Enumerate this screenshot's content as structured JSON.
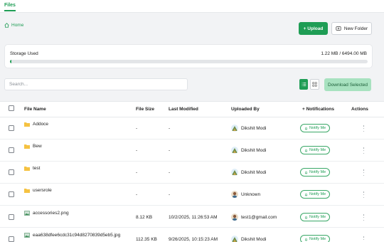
{
  "tabs": {
    "files": "Files"
  },
  "breadcrumb": {
    "home": "Home"
  },
  "actions": {
    "upload": "+ Upload",
    "new_folder": "New Folder",
    "download_selected": "Download Selected"
  },
  "storage": {
    "label": "Storage Used",
    "value": "1.22 MB / 6494.00 MB",
    "used_fraction": 0.0002
  },
  "search": {
    "placeholder": "Search..."
  },
  "table": {
    "headers": {
      "file_name": "File Name",
      "file_size": "File Size",
      "last_modified": "Last Modified",
      "uploaded_by": "Uploaded By",
      "notifications": "+ Notifications",
      "actions": "Actions"
    },
    "notify_label": "Notify Me",
    "rows": [
      {
        "name": "Addoce",
        "type": "folder",
        "size": "-",
        "modified": "-",
        "uploaded_by": "Dikshit Modi",
        "avatar": "landscape-avatar"
      },
      {
        "name": "Bew",
        "type": "folder",
        "size": "-",
        "modified": "-",
        "uploaded_by": "Dikshit Modi",
        "avatar": "landscape-avatar"
      },
      {
        "name": "test",
        "type": "folder",
        "size": "-",
        "modified": "-",
        "uploaded_by": "Dikshit Modi",
        "avatar": "landscape-avatar"
      },
      {
        "name": "usersrole",
        "type": "folder",
        "size": "-",
        "modified": "-",
        "uploaded_by": "Unknown",
        "avatar": "person-avatar"
      },
      {
        "name": "accessories2.png",
        "type": "image",
        "size": "8.12 KB",
        "modified": "10/2/2025, 11:26:53 AM",
        "uploaded_by": "test1@gmail.com",
        "avatar": "person-avatar"
      },
      {
        "name": "eaa638dfee6cdc31c94d8270839d5eb5.jpg",
        "type": "image",
        "size": "112.35 KB",
        "modified": "9/26/2025, 10:15:23 AM",
        "uploaded_by": "Dikshit Modi",
        "avatar": "landscape-avatar"
      }
    ]
  },
  "colors": {
    "accent": "#1f9d55",
    "download_bg": "#a8e2c0",
    "folder": "#f5c242"
  }
}
